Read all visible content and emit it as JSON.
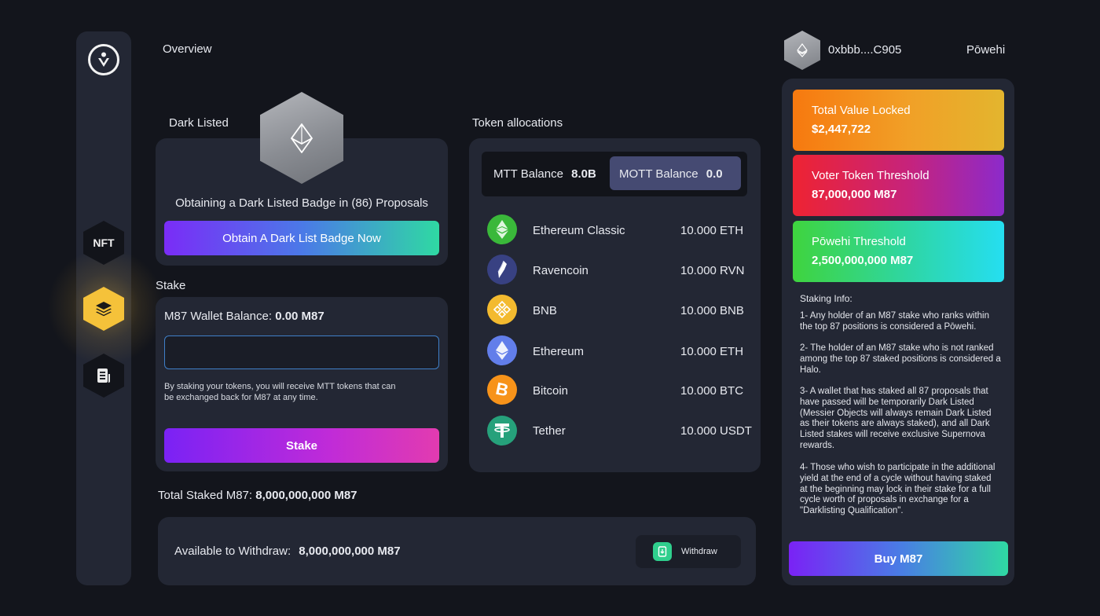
{
  "header": {
    "page_title": "Overview",
    "address": "0xbbb....C905",
    "username": "Pōwehi"
  },
  "sidebar": {
    "items": [
      {
        "label": "NFT",
        "icon": "nft-icon"
      },
      {
        "label": "",
        "icon": "layers-icon",
        "active": true
      },
      {
        "label": "",
        "icon": "document-icon"
      }
    ]
  },
  "dark_listed": {
    "title": "Dark Listed",
    "badge_text": "Obtaining a Dark Listed Badge in (86) Proposals",
    "button_label": "Obtain A Dark List Badge Now"
  },
  "stake": {
    "title": "Stake",
    "wallet_label": "M87 Wallet Balance:",
    "wallet_value": "0.00 M87",
    "input_value": "",
    "note": "By staking your tokens, you will receive MTT tokens that can be exchanged back for M87 at any time.",
    "button_label": "Stake"
  },
  "totals": {
    "total_staked_label": "Total Staked M87:",
    "total_staked_value": "8,000,000,000 M87",
    "available_label": "Available to Withdraw:",
    "available_value": "8,000,000,000 M87",
    "withdraw_label": "Withdraw"
  },
  "token_allocations": {
    "title": "Token allocations",
    "mtt_label": "MTT Balance",
    "mtt_value": "8.0B",
    "mott_label": "MOTT Balance",
    "mott_value": "0.0",
    "tokens": [
      {
        "name": "Ethereum Classic",
        "amount": "10.000 ETH",
        "icon": "ethereum-classic-icon",
        "color": "#3ab83a"
      },
      {
        "name": "Ravencoin",
        "amount": "10.000 RVN",
        "icon": "ravencoin-icon",
        "color": "#384182"
      },
      {
        "name": "BNB",
        "amount": "10.000 BNB",
        "icon": "bnb-icon",
        "color": "#f3ba2f"
      },
      {
        "name": "Ethereum",
        "amount": "10.000 ETH",
        "icon": "ethereum-icon",
        "color": "#627eea"
      },
      {
        "name": "Bitcoin",
        "amount": "10.000 BTC",
        "icon": "bitcoin-icon",
        "color": "#f7931a"
      },
      {
        "name": "Tether",
        "amount": "10.000 USDT",
        "icon": "tether-icon",
        "color": "#26a17b"
      }
    ]
  },
  "stats": {
    "tvl_label": "Total Value Locked",
    "tvl_value": "$2,447,722",
    "voter_label": "Voter Token Threshold",
    "voter_value": "87,000,000 M87",
    "powehi_label": "Pōwehi Threshold",
    "powehi_value": "2,500,000,000 M87"
  },
  "staking_info": {
    "title": "Staking Info:",
    "p1": "1- Any holder of an M87 stake who ranks within the top 87 positions is considered a Pōwehi.",
    "p2": "2- The holder of an M87 stake who is not ranked among the top 87 staked positions is considered a Halo.",
    "p3": "3- A wallet that has staked all 87 proposals that have passed will be temporarily Dark Listed (Messier Objects will always remain Dark Listed as their tokens are always staked), and all Dark Listed stakes will receive exclusive Supernova rewards.",
    "p4": "4- Those who wish to participate in the additional yield at the end of a cycle without having staked at the beginning may lock in their stake for a full cycle worth of proposals in exchange for a \"Darklisting Qualification\".",
    "buy_label": "Buy M87"
  },
  "colors": {
    "background": "#13151c",
    "card": "#232734",
    "accent_yellow": "#f5c23a",
    "input_border": "#3f7fc8"
  }
}
